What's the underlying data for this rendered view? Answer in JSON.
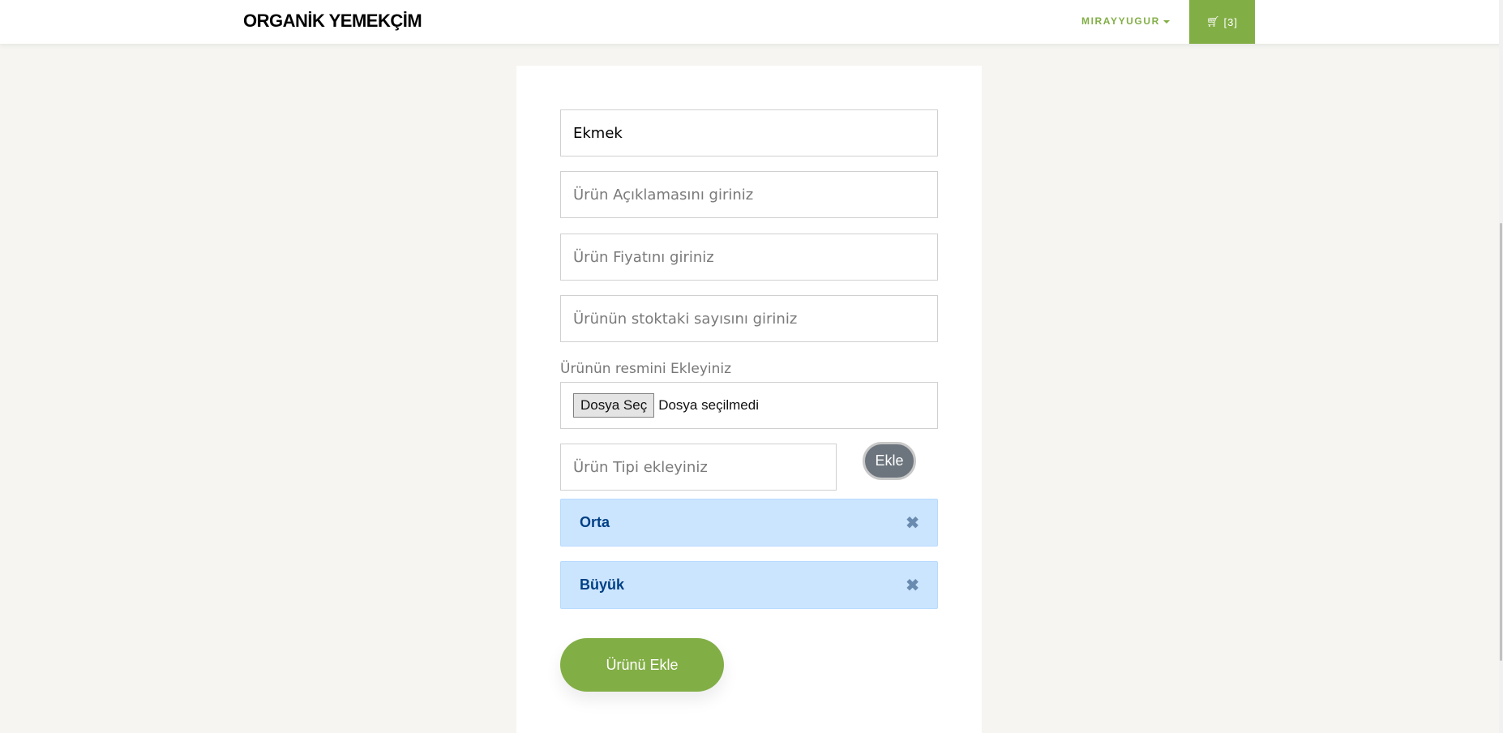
{
  "header": {
    "brand": "ORGANİK YEMEKÇİM",
    "user": "MIRAYYUGUR",
    "cart_count": "[3]",
    "cart_icon": "shopping-cart-icon"
  },
  "form": {
    "name_value": "Ekmek",
    "description_placeholder": "Ürün Açıklamasını giriniz",
    "price_placeholder": "Ürün Fiyatını giriniz",
    "stock_placeholder": "Ürünün stoktaki sayısını giriniz",
    "image_label": "Ürünün resmini Ekleyiniz",
    "file_button": "Dosya Seç",
    "file_status": "Dosya seçilmedi",
    "type_placeholder": "Ürün Tipi ekleyiniz",
    "add_type_button": "Ekle",
    "types": [
      "Orta",
      "Büyük"
    ],
    "submit_button": "Ürünü Ekle"
  },
  "colors": {
    "accent": "#82ae46",
    "tag_bg": "#cce5ff",
    "tag_text": "#004085",
    "secondary_button": "#6c757d"
  }
}
